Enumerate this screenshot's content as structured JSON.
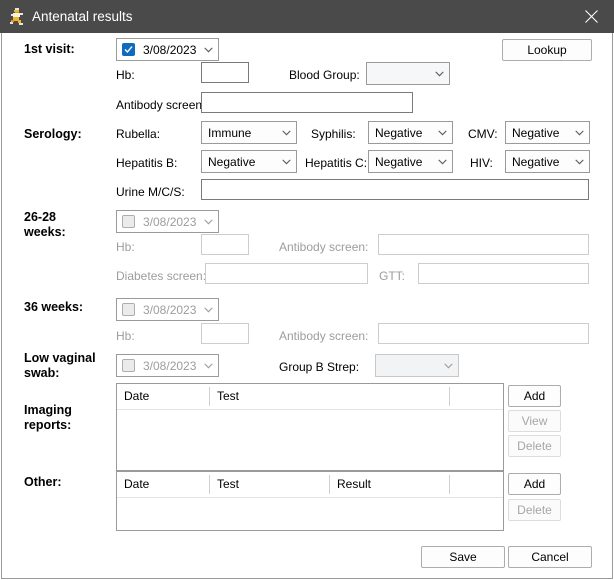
{
  "window": {
    "title": "Antenatal results",
    "icon": "runner-icon",
    "close_icon": "close-icon",
    "titlebar_color": "#4a4a4a",
    "accent_color": "#0f6cbd"
  },
  "first_visit": {
    "section_label": "1st visit:",
    "date": {
      "checked": true,
      "value": "3/08/2023",
      "arrow_icon": "chevron-down-icon"
    },
    "lookup_label": "Lookup",
    "hb_label": "Hb:",
    "hb_value": "",
    "blood_group_label": "Blood Group:",
    "blood_group_value": "",
    "antibody_label": "Antibody screen:",
    "antibody_value": ""
  },
  "serology": {
    "section_label": "Serology:",
    "rubella_label": "Rubella:",
    "rubella_value": "Immune",
    "syphilis_label": "Syphilis:",
    "syphilis_value": "Negative",
    "cmv_label": "CMV:",
    "cmv_value": "Negative",
    "hep_b_label": "Hepatitis B:",
    "hep_b_value": "Negative",
    "hep_c_label": "Hepatitis C:",
    "hep_c_value": "Negative",
    "hiv_label": "HIV:",
    "hiv_value": "Negative",
    "urine_label": "Urine M/C/S:",
    "urine_value": ""
  },
  "weeks_26_28": {
    "section_label": "26-28\nweeks:",
    "enabled": false,
    "date": {
      "checked": false,
      "value": "3/08/2023",
      "arrow_icon": "chevron-down-icon"
    },
    "hb_label": "Hb:",
    "hb_value": "",
    "antibody_label": "Antibody screen:",
    "antibody_value": "",
    "diabetes_label": "Diabetes screen:",
    "diabetes_value": "",
    "gtt_label": "GTT:",
    "gtt_value": ""
  },
  "weeks_36": {
    "section_label": "36 weeks:",
    "enabled": false,
    "date": {
      "checked": false,
      "value": "3/08/2023",
      "arrow_icon": "chevron-down-icon"
    },
    "hb_label": "Hb:",
    "hb_value": "",
    "antibody_label": "Antibody screen:",
    "antibody_value": ""
  },
  "low_vaginal_swab": {
    "section_label": "Low vaginal\nswab:",
    "date": {
      "checked": false,
      "value": "3/08/2023",
      "arrow_icon": "chevron-down-icon"
    },
    "group_b_strep_label": "Group B Strep:",
    "group_b_strep_value": ""
  },
  "imaging_reports": {
    "section_label": "Imaging\nreports:",
    "columns": [
      "Date",
      "Test"
    ],
    "rows": [],
    "buttons": [
      {
        "label": "Add",
        "enabled": true
      },
      {
        "label": "View",
        "enabled": false
      },
      {
        "label": "Delete",
        "enabled": false
      }
    ]
  },
  "other": {
    "section_label": "Other:",
    "columns": [
      "Date",
      "Test",
      "Result"
    ],
    "rows": [],
    "buttons": [
      {
        "label": "Add",
        "enabled": true
      },
      {
        "label": "Delete",
        "enabled": false
      }
    ]
  },
  "footer": {
    "save_label": "Save",
    "cancel_label": "Cancel"
  }
}
